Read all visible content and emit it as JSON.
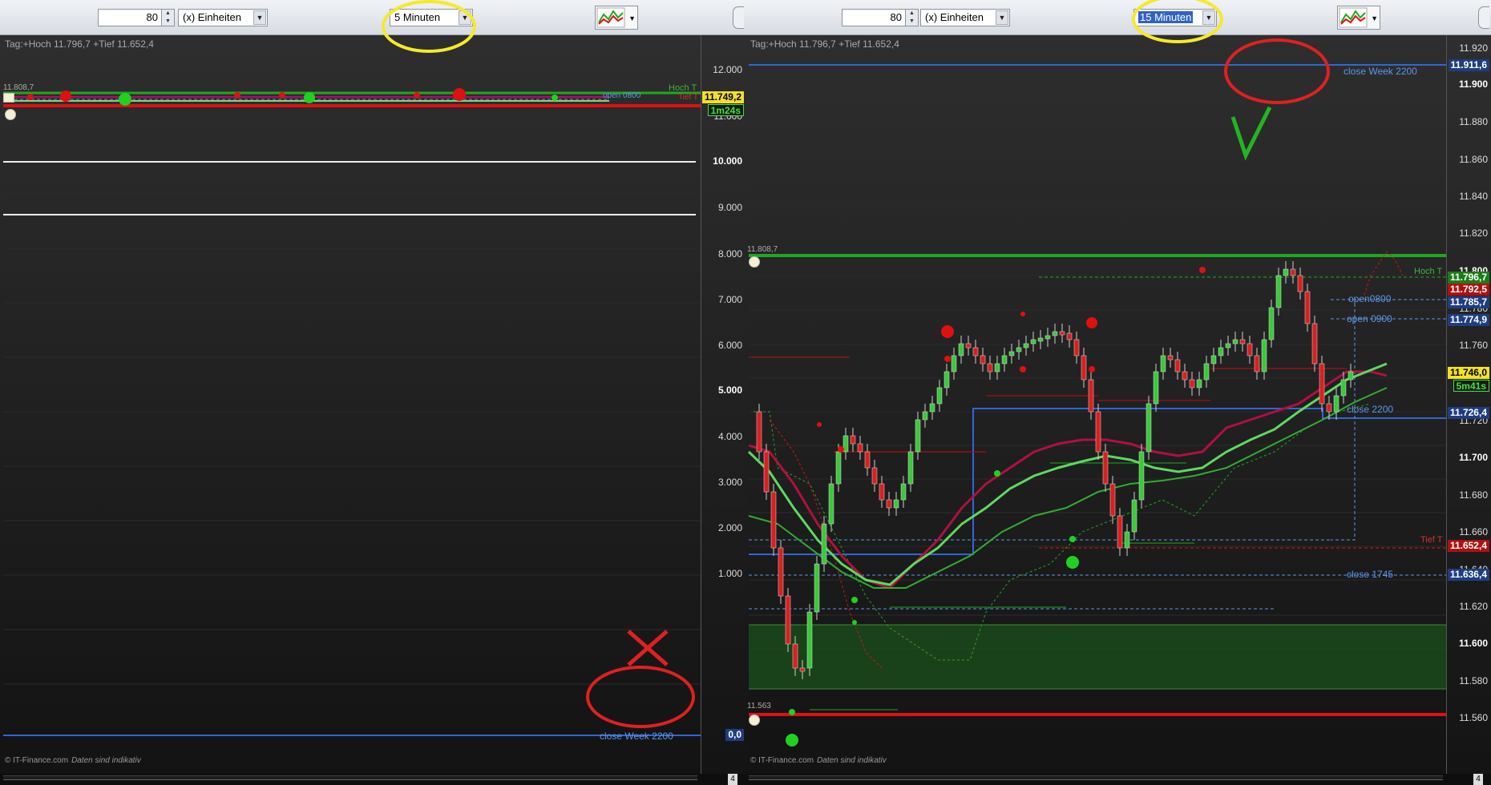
{
  "left": {
    "toolbar": {
      "quantity": "80",
      "unit": "(x) Einheiten",
      "interval": "5 Minuten"
    },
    "header": "Tag:+Hoch 11.796,7 +Tief 11.652,4",
    "yaxis": [
      "12.000",
      "11.000",
      "10.000",
      "9.000",
      "8.000",
      "7.000",
      "6.000",
      "5.000",
      "4.000",
      "3.000",
      "2.000",
      "1.000"
    ],
    "top_marker": "11.808,7",
    "hoch_label": "Hoch T",
    "tief_label": "Tief T",
    "open_label": "open 0800",
    "price_box": "11.749,2",
    "timer_box": "1m24s",
    "close_week_label": "close Week 2200",
    "close_week_box": "0,0",
    "copyright": "© IT-Finance.com",
    "disclaimer": "Daten sind indikativ",
    "page": "4"
  },
  "right": {
    "toolbar": {
      "quantity": "80",
      "unit": "(x) Einheiten",
      "interval": "15 Minuten"
    },
    "header": "Tag:+Hoch 11.796,7 +Tief 11.652,4",
    "yaxis": [
      {
        "v": "11.920",
        "b": false
      },
      {
        "v": "11.900",
        "b": true
      },
      {
        "v": "11.880",
        "b": false
      },
      {
        "v": "11.860",
        "b": false
      },
      {
        "v": "11.840",
        "b": false
      },
      {
        "v": "11.820",
        "b": false
      },
      {
        "v": "11.800",
        "b": true
      },
      {
        "v": "11.780",
        "b": false
      },
      {
        "v": "11.760",
        "b": false
      },
      {
        "v": "11.720",
        "b": false
      },
      {
        "v": "11.700",
        "b": true
      },
      {
        "v": "11.680",
        "b": false
      },
      {
        "v": "11.660",
        "b": false
      },
      {
        "v": "11.640",
        "b": false
      },
      {
        "v": "11.620",
        "b": false
      },
      {
        "v": "11.600",
        "b": true
      },
      {
        "v": "11.580",
        "b": false
      },
      {
        "v": "11.560",
        "b": false
      }
    ],
    "top_marker": "11.808,7",
    "low_marker": "11.563",
    "labels": {
      "close_week": "close Week 2200",
      "hoch": "Hoch T",
      "open0800": "open0800",
      "open0900": "open 0900",
      "close2200": "close 2200",
      "tief": "Tief T",
      "close1745": "close 1745"
    },
    "boxes": {
      "close_week": "11.911,6",
      "hoch": "11.796,7",
      "red_top": "11.792,5",
      "open0800": "11.785,7",
      "open0900": "11.774,9",
      "price": "11.746,0",
      "timer": "5m41s",
      "close2200": "11.726,4",
      "tief": "11.652,4",
      "close1745": "11.636,4"
    },
    "copyright": "© IT-Finance.com",
    "disclaimer": "Daten sind indikativ",
    "page": "4"
  },
  "colors": {
    "yellow": "#f4ea2a",
    "annot_red": "#e02020",
    "annot_green": "#22b522",
    "level_green": "#1fa81f",
    "level_red": "#e01010",
    "level_blue": "#2f66d8"
  }
}
